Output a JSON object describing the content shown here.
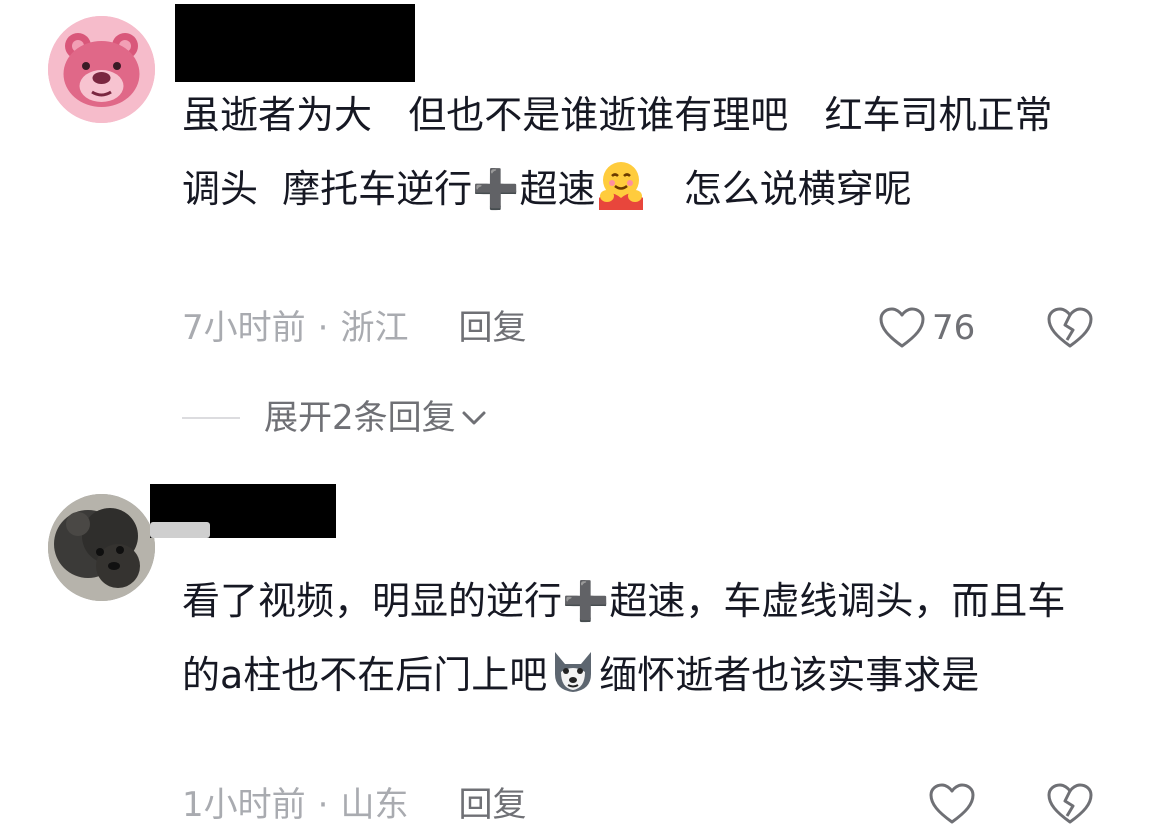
{
  "comments": [
    {
      "text_parts": [
        "虽逝者为大   但也不是谁逝谁有理吧   红车司机正常调头  摩托车逆行➕超速",
        "   怎么说横穿呢"
      ],
      "inline_emoji": "hugging-face-emoji",
      "time": "7小时前",
      "separator": "·",
      "location": "浙江",
      "reply_label": "回复",
      "like_count": "76",
      "expand_label": "展开2条回复"
    },
    {
      "text_parts": [
        "看了视频，明显的逆行➕超速，车虚线调头，而且车的a柱也不在后门上吧",
        "缅怀逝者也该实事求是"
      ],
      "inline_emoji": "wolf-emoji",
      "time": "1小时前",
      "separator": "·",
      "location": "山东",
      "reply_label": "回复",
      "like_count": ""
    }
  ],
  "colors": {
    "primary_text": "#161823",
    "secondary_text": "#a9abb0",
    "action_text": "#6f7075"
  }
}
